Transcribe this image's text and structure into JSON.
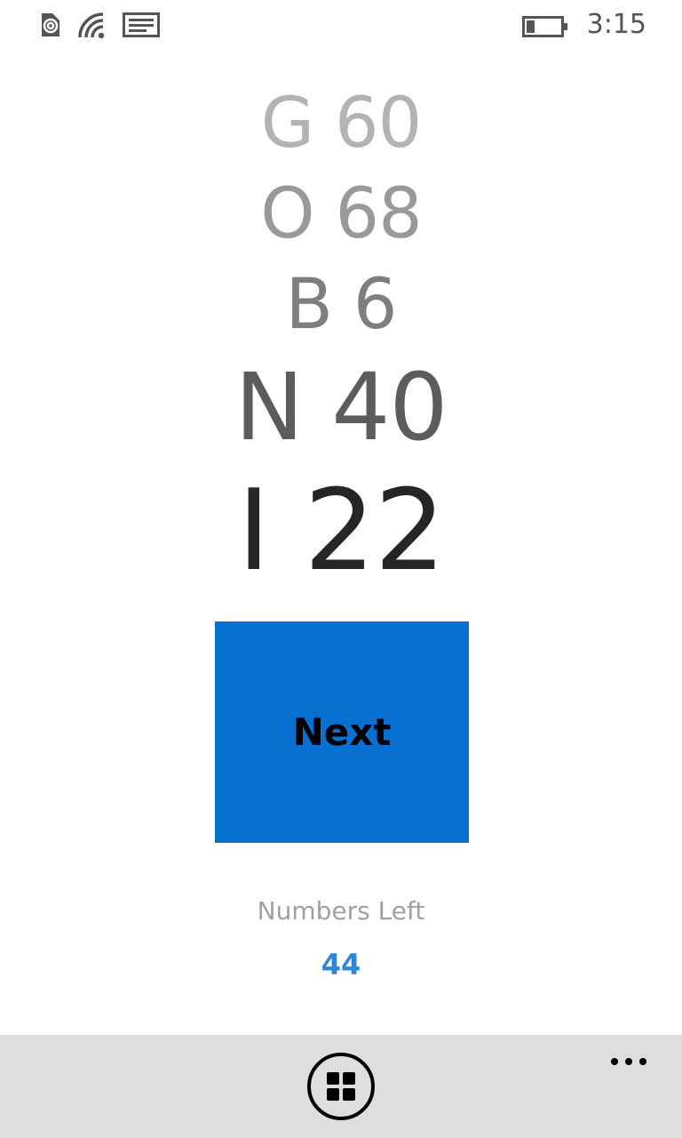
{
  "status_bar": {
    "time": "3:15",
    "icons": [
      "nfc-icon",
      "wifi-icon",
      "message-icon",
      "battery-icon"
    ]
  },
  "called_numbers": [
    {
      "letter": "G",
      "number": "60",
      "text": "G 60"
    },
    {
      "letter": "O",
      "number": "68",
      "text": "O 68"
    },
    {
      "letter": "B",
      "number": "6",
      "text": "B 6"
    },
    {
      "letter": "N",
      "number": "40",
      "text": "N 40"
    },
    {
      "letter": "I",
      "number": "22",
      "text": "I 22"
    }
  ],
  "next_button": {
    "label": "Next"
  },
  "numbers_left": {
    "label": "Numbers Left",
    "count": "44"
  },
  "app_bar": {
    "primary_icon": "grid-icon",
    "more_icon": "more-ellipsis-icon"
  },
  "colors": {
    "accent": "#0870d0",
    "count_text": "#2f86d6",
    "app_bar_bg": "#dedede"
  }
}
